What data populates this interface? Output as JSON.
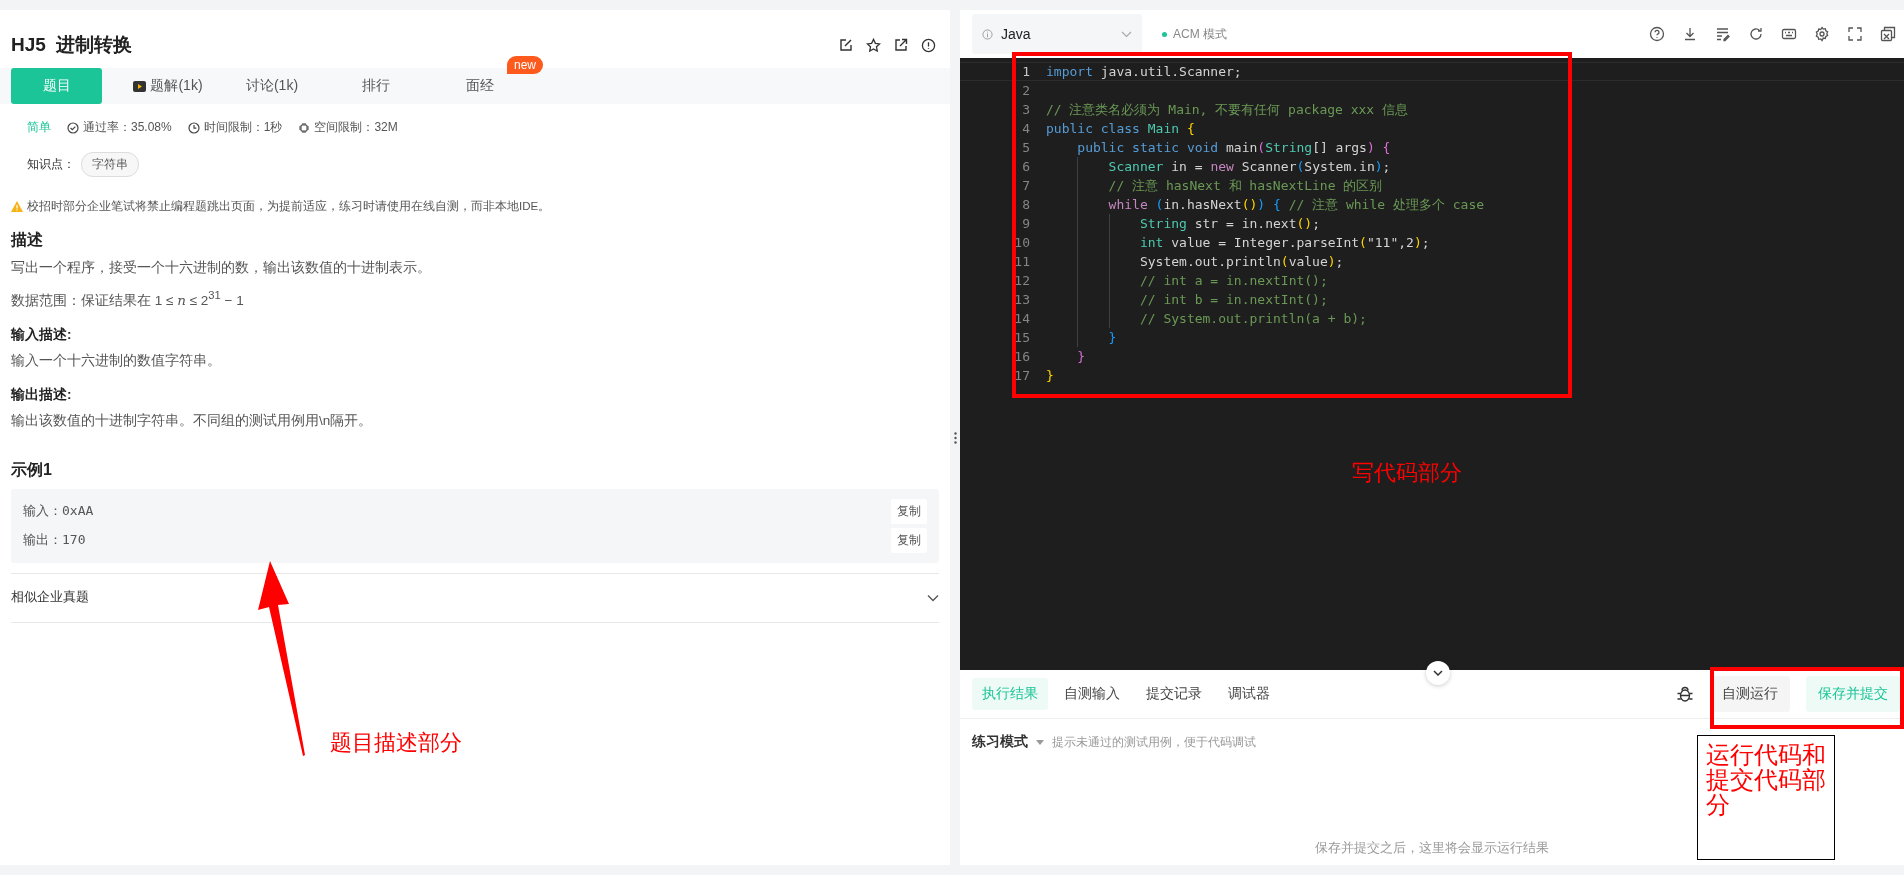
{
  "problem": {
    "title": "HJ5  进制转换",
    "tabs": [
      {
        "label": "题目",
        "selected": true
      },
      {
        "label": "题解(1k)",
        "selected": false,
        "kind": "video"
      },
      {
        "label": "讨论(1k)",
        "selected": false
      },
      {
        "label": "排行",
        "selected": false
      },
      {
        "label": "面经",
        "selected": false,
        "badge": "new"
      }
    ],
    "meta": [
      {
        "kind": "difficulty",
        "text": "简单"
      },
      {
        "kind": "pass",
        "text": "通过率：35.08%"
      },
      {
        "kind": "time",
        "text": "时间限制：1秒"
      },
      {
        "kind": "memory",
        "text": "空间限制：32M"
      }
    ],
    "topics_label": "知识点：",
    "topics": [
      "字符串"
    ],
    "notice": "校招时部分企业笔试将禁止编程题跳出页面，为提前适应，练习时请使用在线自测，而非本地IDE。",
    "sections": [
      {
        "heading": "描述",
        "paragraphs": [
          "写出一个程序，接受一个十六进制的数，输出该数值的十进制表示。",
          "数据范围：保证结果在 1 ≤ *n* ≤ 2$^{31}$ − 1"
        ]
      },
      {
        "heading": "输入描述:",
        "paragraphs": [
          "输入一个十六进制的数值字符串。"
        ]
      },
      {
        "heading": "输出描述:",
        "paragraphs": [
          "输出该数值的十进制字符串。不同组的测试用例用\\n隔开。"
        ]
      }
    ],
    "example": {
      "title": "示例1",
      "rows": [
        {
          "label": "输入：",
          "value": "0xAA",
          "copy": "复制"
        },
        {
          "label": "输出：",
          "value": "170",
          "copy": "复制"
        }
      ]
    },
    "similar": {
      "title": "相似企业真题",
      "expanded": false
    }
  },
  "editor": {
    "language": "Java",
    "mode": "ACM 模式",
    "lines": [
      {
        "number": "1",
        "current": true,
        "tokens": [
          {
            "text": "import",
            "kind": "kw"
          },
          {
            "text": " java.util.Scanner;",
            "kind": "plain"
          }
        ]
      },
      {
        "number": "2",
        "current": false
      },
      {
        "number": "3",
        "current": false,
        "tokens": [
          {
            "text": "// 注意类名必须为 Main, 不要有任何 package xxx 信息",
            "kind": "comment"
          }
        ]
      },
      {
        "number": "4",
        "current": false,
        "tokens": [
          {
            "text": "public class ",
            "kind": "kw"
          },
          {
            "text": "Main ",
            "kind": "type"
          },
          {
            "text": "{",
            "kind": "b1"
          }
        ]
      },
      {
        "number": "5",
        "current": false,
        "tokens": [
          {
            "text": "    public static void ",
            "kind": "kw"
          },
          {
            "text": "main",
            "kind": "plain"
          },
          {
            "text": "(",
            "kind": "b2"
          },
          {
            "text": "String",
            "kind": "type"
          },
          {
            "text": "[] args",
            "kind": "plain"
          },
          {
            "text": ") ",
            "kind": "b2"
          },
          {
            "text": "{",
            "kind": "b2"
          }
        ]
      },
      {
        "number": "6",
        "current": false,
        "tokens": [
          {
            "text": "        Scanner",
            "kind": "type"
          },
          {
            "text": " in = ",
            "kind": "plain"
          },
          {
            "text": "new",
            "kind": "ctrl"
          },
          {
            "text": " Scanner",
            "kind": "plain"
          },
          {
            "text": "(",
            "kind": "b3"
          },
          {
            "text": "System.in",
            "kind": "plain"
          },
          {
            "text": ")",
            "kind": "b3"
          },
          {
            "text": ";",
            "kind": "plain"
          }
        ]
      },
      {
        "number": "7",
        "current": false,
        "tokens": [
          {
            "text": "        // 注意 hasNext 和 hasNextLine 的区别",
            "kind": "comment"
          }
        ]
      },
      {
        "number": "8",
        "current": false,
        "tokens": [
          {
            "text": "        while ",
            "kind": "ctrl"
          },
          {
            "text": "(",
            "kind": "b3"
          },
          {
            "text": "in.hasNext",
            "kind": "plain"
          },
          {
            "text": "()",
            "kind": "b1"
          },
          {
            "text": ") ",
            "kind": "b3"
          },
          {
            "text": "{",
            "kind": "b3"
          },
          {
            "text": " // 注意 while 处理多个 case",
            "kind": "comment"
          }
        ]
      },
      {
        "number": "9",
        "current": false,
        "tokens": [
          {
            "text": "            String",
            "kind": "type"
          },
          {
            "text": " str = in.next",
            "kind": "plain"
          },
          {
            "text": "()",
            "kind": "b1"
          },
          {
            "text": ";",
            "kind": "plain"
          }
        ]
      },
      {
        "number": "10",
        "current": false,
        "tokens": [
          {
            "text": "            int",
            "kind": "type"
          },
          {
            "text": " value = Integer.parseInt",
            "kind": "plain"
          },
          {
            "text": "(",
            "kind": "b1"
          },
          {
            "text": "\"11\",2",
            "kind": "plain"
          },
          {
            "text": ")",
            "kind": "b1"
          },
          {
            "text": ";",
            "kind": "plain"
          }
        ]
      },
      {
        "number": "11",
        "current": false,
        "tokens": [
          {
            "text": "            System.out.println",
            "kind": "plain"
          },
          {
            "text": "(",
            "kind": "b1"
          },
          {
            "text": "value",
            "kind": "plain"
          },
          {
            "text": ")",
            "kind": "b1"
          },
          {
            "text": ";",
            "kind": "plain"
          }
        ]
      },
      {
        "number": "12",
        "current": false,
        "tokens": [
          {
            "text": "            // int a = in.nextInt();",
            "kind": "comment"
          }
        ]
      },
      {
        "number": "13",
        "current": false,
        "tokens": [
          {
            "text": "            // int b = in.nextInt();",
            "kind": "comment"
          }
        ]
      },
      {
        "number": "14",
        "current": false,
        "tokens": [
          {
            "text": "            // System.out.println(a + b);",
            "kind": "comment"
          }
        ]
      },
      {
        "number": "15",
        "current": false,
        "tokens": [
          {
            "text": "        }",
            "kind": "b3"
          }
        ]
      },
      {
        "number": "16",
        "current": false,
        "tokens": [
          {
            "text": "    }",
            "kind": "b2"
          }
        ]
      },
      {
        "number": "17",
        "current": false,
        "tokens": [
          {
            "text": "}",
            "kind": "b1"
          }
        ]
      }
    ]
  },
  "results": {
    "tabs": [
      {
        "label": "执行结果",
        "selected": true
      },
      {
        "label": "自测输入",
        "selected": false
      },
      {
        "label": "提交记录",
        "selected": false
      },
      {
        "label": "调试器",
        "selected": false
      }
    ],
    "run_button": "自测运行",
    "submit_button": "保存并提交",
    "mode": "练习模式",
    "hint": "提示未通过的测试用例，便于代码调试",
    "empty": "保存并提交之后，这里将会显示运行结果"
  },
  "annotations": {
    "code_label": "写代码部分",
    "problem_label": "题目描述部分",
    "actions_label": "运行代码和提交代码部分"
  }
}
